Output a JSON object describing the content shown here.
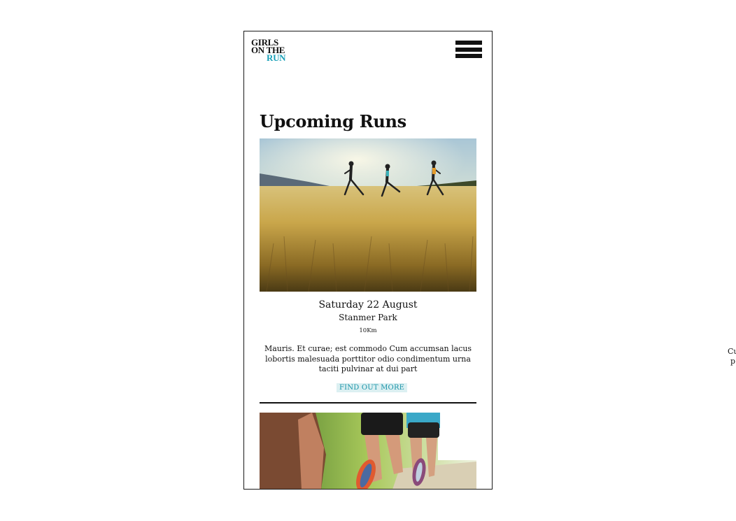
{
  "logo": {
    "line1": "GIRLS",
    "line2": "ON THE",
    "line3": "RUN"
  },
  "colors": {
    "accent": "#1aa0b8",
    "button_bg": "#dcf0f2",
    "text": "#111111"
  },
  "menu_icon": "hamburger-icon",
  "section": {
    "title": "Upcoming Runs"
  },
  "event": {
    "date": "Saturday 22 August",
    "location": "Stanmer Park",
    "distance": "10Km",
    "description": "Mauris. Et curae; est commodo Cum accumsan lacus lobortis malesuada porttitor odio condimentum urna taciti pulvinar at dui part",
    "button_label": "FIND OUT MORE"
  },
  "offscreen_text": {
    "line1": "Cu",
    "line2": "p"
  }
}
